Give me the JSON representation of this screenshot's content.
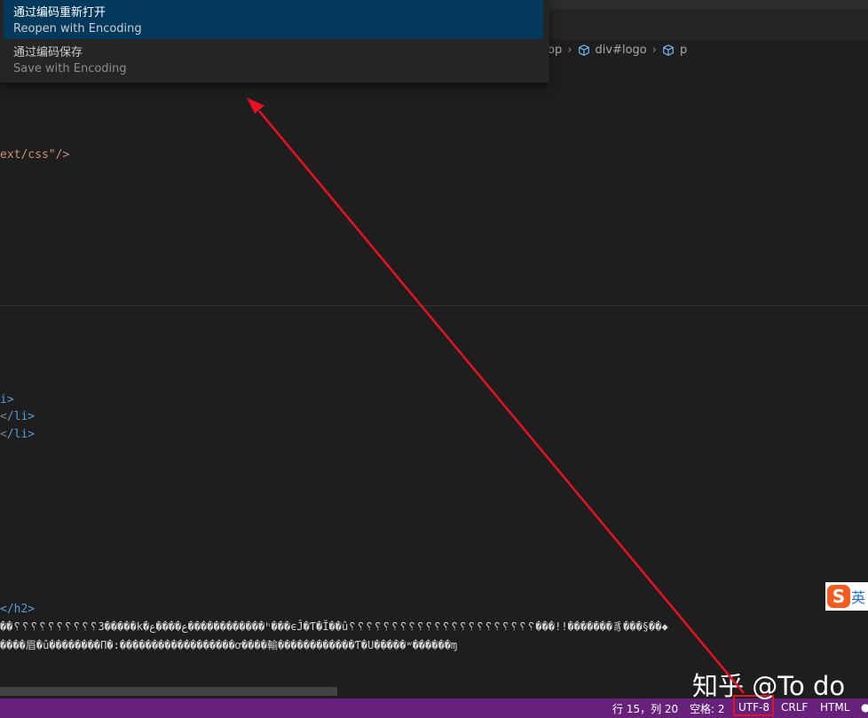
{
  "menu": {
    "items": [
      {
        "title": "通过编码重新打开",
        "description": "Reopen with Encoding",
        "selected": true
      },
      {
        "title": "通过编码保存",
        "description": "Save with Encoding",
        "selected": false
      }
    ]
  },
  "breadcrumb": {
    "items": [
      "top",
      "div#logo",
      "p"
    ]
  },
  "editor": {
    "line_top": "ext/css\"/>",
    "li_lines": [
      {
        "prefix": "",
        "tag": "i>"
      },
      {
        "prefix": "<",
        "tag": "/li>"
      },
      {
        "prefix": "<",
        "tag": "/li>"
      }
    ],
    "h2_line": "</h2>",
    "garbled_line1": "��␦␦␦␦␦␦␦␦␦␦3�����k�ع����ع������������ʰ���ϵĴ�Ƭ�Ĭ��û␦␦␦␦␦␦␦␦␦␦␦␦␦␦␦␦␦␦␦␦␦␦���!!�������豸���§��◆",
    "garbled_line2": "����眉�û��������Π�:������������������ơ����輸������������Ƭ�U�����ʷ������ɱ"
  },
  "status_bar": {
    "position": "行 15，列 20",
    "spaces": "空格: 2",
    "encoding": "UTF-8",
    "eol": "CRLF",
    "language": "HTML"
  },
  "watermark": "知乎 @To do",
  "ime_label": "英",
  "colors": {
    "status_bar": "#68217a",
    "menu_selected": "#04395e",
    "arrow": "#e81123"
  }
}
